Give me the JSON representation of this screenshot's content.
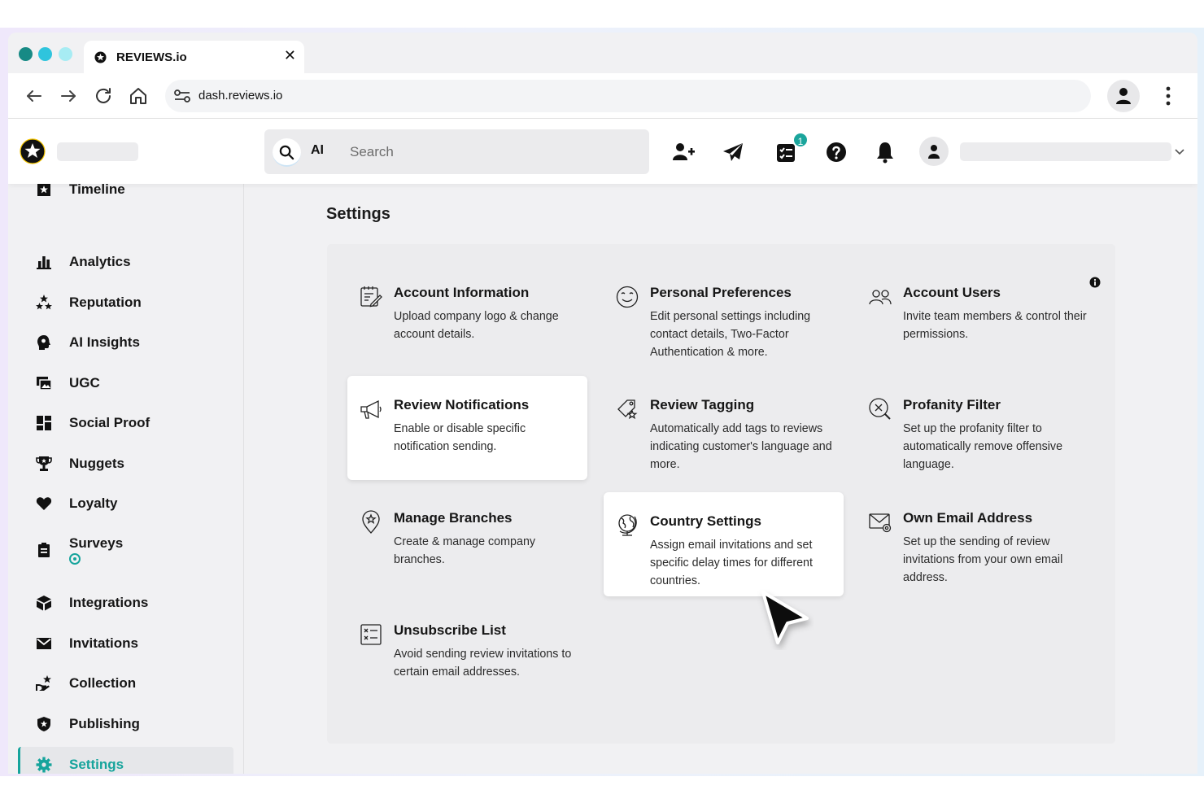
{
  "browser": {
    "tab_title": "REVIEWS.io",
    "tab_close": "✕",
    "url": "dash.reviews.io"
  },
  "header": {
    "search_ai_label": "AI",
    "search_placeholder": "Search",
    "checklist_badge_count": "1"
  },
  "sidebar": {
    "items": [
      {
        "label": "Timeline",
        "icon": "timeline-icon"
      },
      {
        "label": "Analytics",
        "icon": "analytics-icon"
      },
      {
        "label": "Reputation",
        "icon": "reputation-icon"
      },
      {
        "label": "AI Insights",
        "icon": "ai-insights-icon"
      },
      {
        "label": "UGC",
        "icon": "ugc-icon"
      },
      {
        "label": "Social Proof",
        "icon": "social-proof-icon"
      },
      {
        "label": "Nuggets",
        "icon": "nuggets-icon"
      },
      {
        "label": "Loyalty",
        "icon": "loyalty-icon"
      },
      {
        "label": "Surveys",
        "icon": "surveys-icon"
      },
      {
        "label": "Integrations",
        "icon": "integrations-icon"
      },
      {
        "label": "Invitations",
        "icon": "invitations-icon"
      },
      {
        "label": "Collection",
        "icon": "collection-icon"
      },
      {
        "label": "Publishing",
        "icon": "publishing-icon"
      },
      {
        "label": "Settings",
        "icon": "settings-icon",
        "active": true
      }
    ]
  },
  "main": {
    "title": "Settings",
    "cards": [
      {
        "title": "Account Information",
        "description": "Upload company logo & change account details.",
        "icon": "account-info-icon"
      },
      {
        "title": "Personal Preferences",
        "description": "Edit personal settings including contact details, Two-Factor Authentication & more.",
        "icon": "smiley-icon"
      },
      {
        "title": "Account Users",
        "description": "Invite team members & control their permissions.",
        "icon": "users-icon"
      },
      {
        "title": "Review Notifications",
        "description": "Enable or disable specific notification sending.",
        "icon": "megaphone-icon"
      },
      {
        "title": "Review Tagging",
        "description": "Automatically add tags to reviews indicating customer's language and more.",
        "icon": "tag-icon"
      },
      {
        "title": "Profanity Filter",
        "description": "Set up the profanity filter to automatically remove offensive language.",
        "icon": "profanity-filter-icon"
      },
      {
        "title": "Manage Branches",
        "description": "Create & manage company branches.",
        "icon": "location-pin-icon"
      },
      {
        "title": "Country Settings",
        "description": "Assign email invitations and set specific delay times for different countries.",
        "icon": "globe-icon"
      },
      {
        "title": "Own Email Address",
        "description": "Set up the sending of review invitations from your own email address.",
        "icon": "email-settings-icon"
      },
      {
        "title": "Unsubscribe List",
        "description": "Avoid sending review invitations to certain email addresses.",
        "icon": "unsubscribe-list-icon"
      }
    ]
  },
  "colors": {
    "accent": "#16a49c",
    "text": "#161616",
    "panel": "#ececee"
  }
}
